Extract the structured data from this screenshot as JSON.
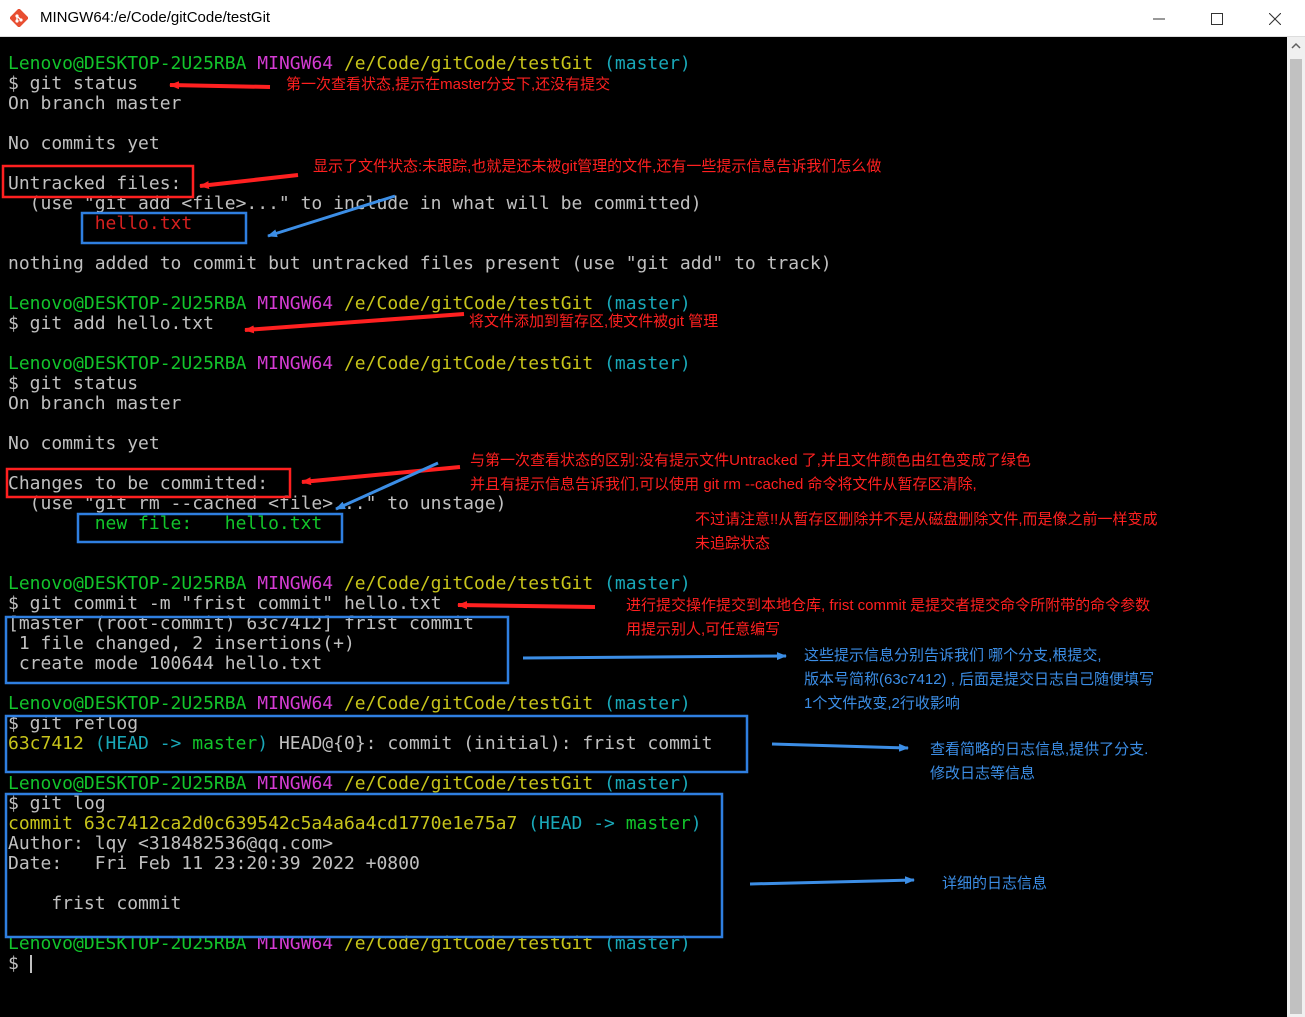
{
  "window": {
    "title": "MINGW64:/e/Code/gitCode/testGit",
    "icons": {
      "app": "git-bash-icon",
      "minimize": "minimize-icon",
      "maximize": "maximize-icon",
      "close": "close-icon"
    }
  },
  "prompt": {
    "user": "Lenovo@DESKTOP-2U25RBA",
    "shell": "MINGW64",
    "path": "/e/Code/gitCode/testGit",
    "branch": "(master)"
  },
  "terminal": {
    "lines": [
      {
        "t": "prompt"
      },
      {
        "t": "text",
        "text": "$ git status"
      },
      {
        "t": "text",
        "text": "On branch master"
      },
      {
        "t": "blank"
      },
      {
        "t": "text",
        "text": "No commits yet"
      },
      {
        "t": "blank"
      },
      {
        "t": "text",
        "text": "Untracked files:"
      },
      {
        "t": "text",
        "text": "  (use \"git add <file>...\" to include in what will be committed)"
      },
      {
        "t": "red",
        "text": "        hello.txt"
      },
      {
        "t": "blank"
      },
      {
        "t": "text",
        "text": "nothing added to commit but untracked files present (use \"git add\" to track)"
      },
      {
        "t": "blank"
      },
      {
        "t": "prompt"
      },
      {
        "t": "text",
        "text": "$ git add hello.txt"
      },
      {
        "t": "blank"
      },
      {
        "t": "prompt"
      },
      {
        "t": "text",
        "text": "$ git status"
      },
      {
        "t": "text",
        "text": "On branch master"
      },
      {
        "t": "blank"
      },
      {
        "t": "text",
        "text": "No commits yet"
      },
      {
        "t": "blank"
      },
      {
        "t": "text",
        "text": "Changes to be committed:"
      },
      {
        "t": "text",
        "text": "  (use \"git rm --cached <file>...\" to unstage)"
      },
      {
        "t": "green",
        "text": "        new file:   hello.txt"
      },
      {
        "t": "blank"
      },
      {
        "t": "blank"
      },
      {
        "t": "prompt"
      },
      {
        "t": "text",
        "text": "$ git commit -m \"frist commit\" hello.txt"
      },
      {
        "t": "text",
        "text": "[master (root-commit) 63c7412] frist commit"
      },
      {
        "t": "text",
        "text": " 1 file changed, 2 insertions(+)"
      },
      {
        "t": "text",
        "text": " create mode 100644 hello.txt"
      },
      {
        "t": "blank"
      },
      {
        "t": "prompt"
      },
      {
        "t": "text",
        "text": "$ git reflog"
      },
      {
        "t": "reflog",
        "hash": "63c7412",
        "head": "(HEAD -> ",
        "branch": "master",
        "close": ")",
        "rest": " HEAD@{0}: commit (initial): frist commit"
      },
      {
        "t": "blank"
      },
      {
        "t": "prompt"
      },
      {
        "t": "text",
        "text": "$ git log"
      },
      {
        "t": "log",
        "commit": "commit 63c7412ca2d0c639542c5a4a6a4cd1770e1e75a7",
        "head": " (HEAD -> ",
        "branch": "master",
        "close": ")"
      },
      {
        "t": "text",
        "text": "Author: lqy <318482536@qq.com>"
      },
      {
        "t": "text",
        "text": "Date:   Fri Feb 11 23:20:39 2022 +0800"
      },
      {
        "t": "blank"
      },
      {
        "t": "text",
        "text": "    frist commit"
      },
      {
        "t": "blank"
      },
      {
        "t": "prompt"
      },
      {
        "t": "cursor",
        "text": "$ "
      }
    ]
  },
  "annotations": [
    {
      "text": "第一次查看状态,提示在master分支下,还没有提交",
      "color": "red"
    },
    {
      "text": "显示了文件状态:未跟踪,也就是还未被git管理的文件,还有一些提示信息告诉我们怎么做",
      "color": "red"
    },
    {
      "text": "将文件添加到暂存区,使文件被git 管理",
      "color": "red"
    },
    {
      "text": "与第一次查看状态的区别:没有提示文件Untracked 了,并且文件颜色由红色变成了绿色\n并且有提示信息告诉我们,可以使用 git rm --cached 命令将文件从暂存区清除,",
      "color": "red"
    },
    {
      "text": "不过请注意!!从暂存区删除并不是从磁盘删除文件,而是像之前一样变成\n未追踪状态",
      "color": "red"
    },
    {
      "text": "进行提交操作提交到本地仓库, frist commit 是提交者提交命令所附带的命令参数\n用提示别人,可任意编写",
      "color": "red"
    },
    {
      "text": "这些提示信息分别告诉我们 哪个分支,根提交,\n版本号简称(63c7412) , 后面是提交日志自己随便填写\n1个文件改变,2行收影响",
      "color": "blue"
    },
    {
      "text": "查看简略的日志信息,提供了分支.\n修改日志等信息",
      "color": "blue"
    },
    {
      "text": "详细的日志信息",
      "color": "blue"
    }
  ],
  "colors": {
    "red_annotation": "#ff2020",
    "blue_annotation": "#3c8ee6",
    "prompt_user": "#12c42b",
    "prompt_shell": "#d43bd3",
    "prompt_path": "#c7c41b",
    "prompt_branch": "#19a8b8"
  }
}
